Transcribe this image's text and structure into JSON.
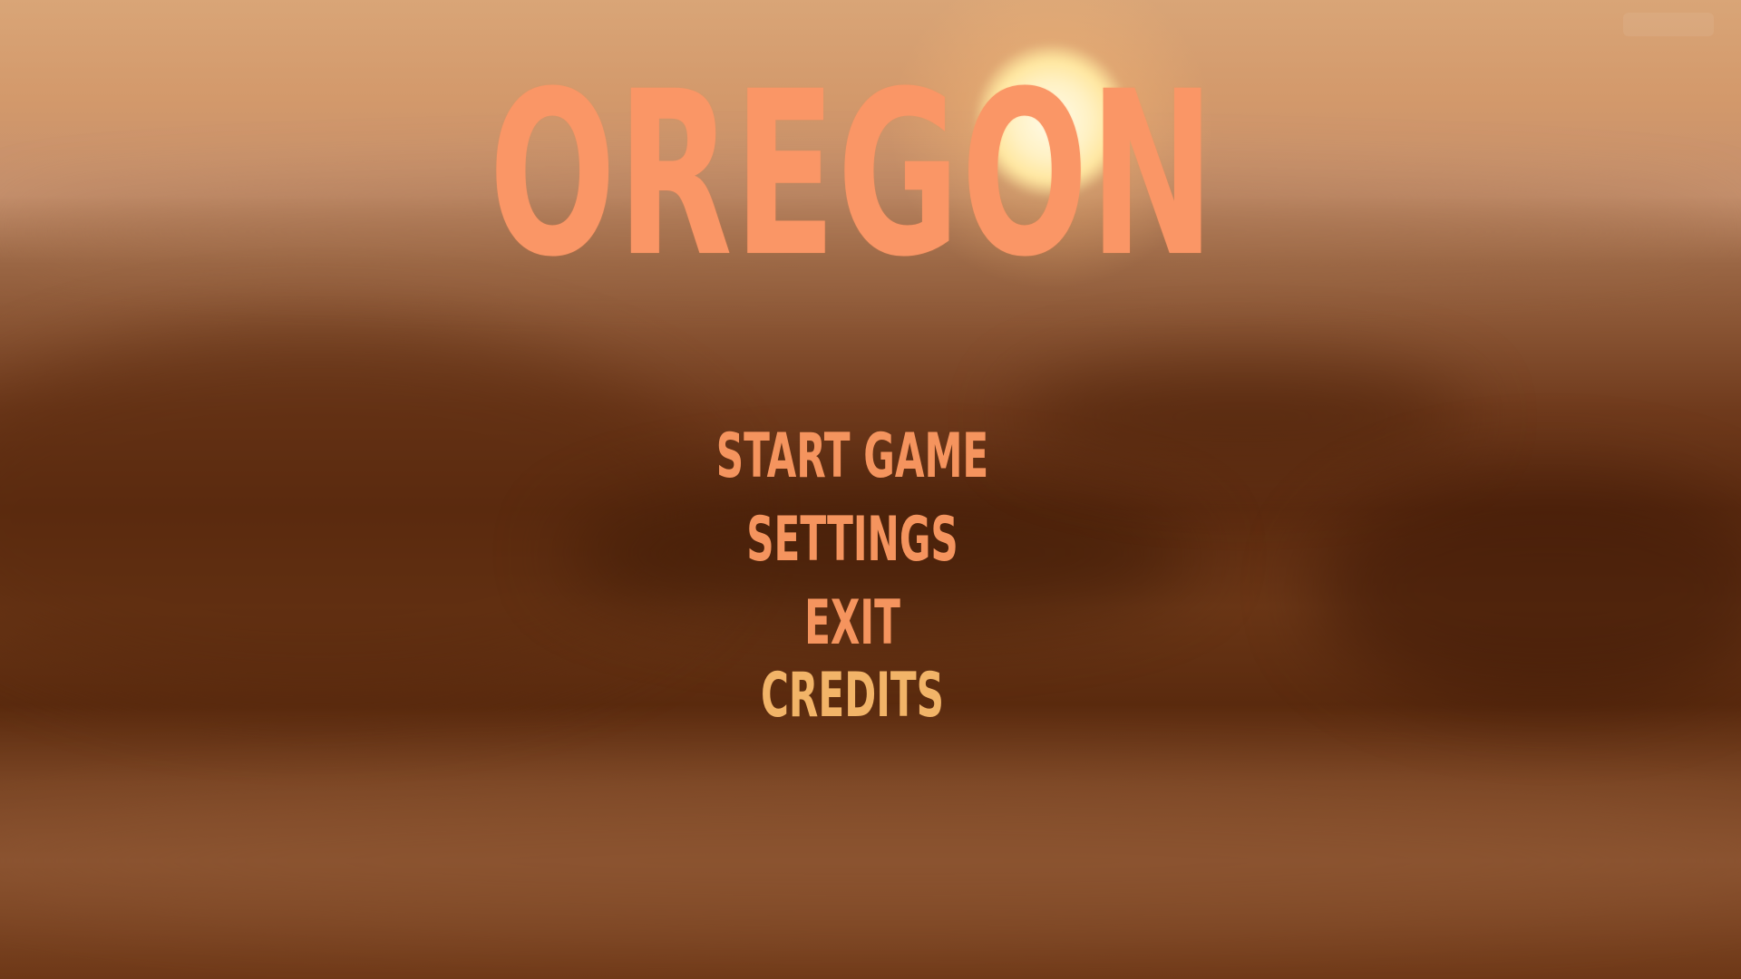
{
  "game": {
    "title": "OREGON"
  },
  "menu": {
    "items": [
      {
        "label": "START GAME"
      },
      {
        "label": "SETTINGS"
      },
      {
        "label": "EXIT"
      },
      {
        "label": "CREDITS"
      }
    ]
  },
  "colors": {
    "title": "#fa9666",
    "menu_item": "#f5945e",
    "menu_item_highlight": "#f2b468",
    "sky": "#d9a577",
    "dune_shadow": "#5c2b10"
  }
}
